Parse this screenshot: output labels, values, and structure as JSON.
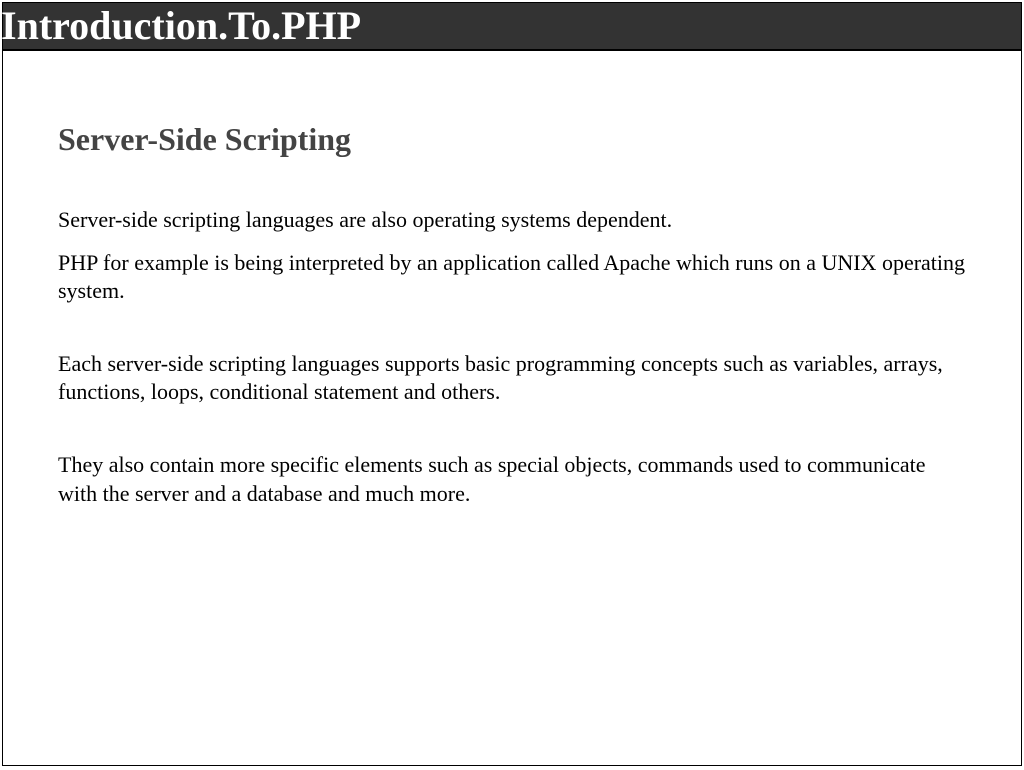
{
  "header": {
    "title": "Introduction.To.PHP"
  },
  "content": {
    "subtitle": "Server-Side Scripting",
    "paragraphs": {
      "p1": "Server-side scripting languages are also operating systems dependent.",
      "p2": "PHP for example is being interpreted by an application called Apache which runs on a UNIX operating system.",
      "p3": "Each server-side scripting languages supports basic programming concepts such as variables, arrays, functions, loops, conditional statement and others.",
      "p4": "They also contain more specific elements such as special objects, commands used to communicate with the server and a database and much more."
    }
  }
}
